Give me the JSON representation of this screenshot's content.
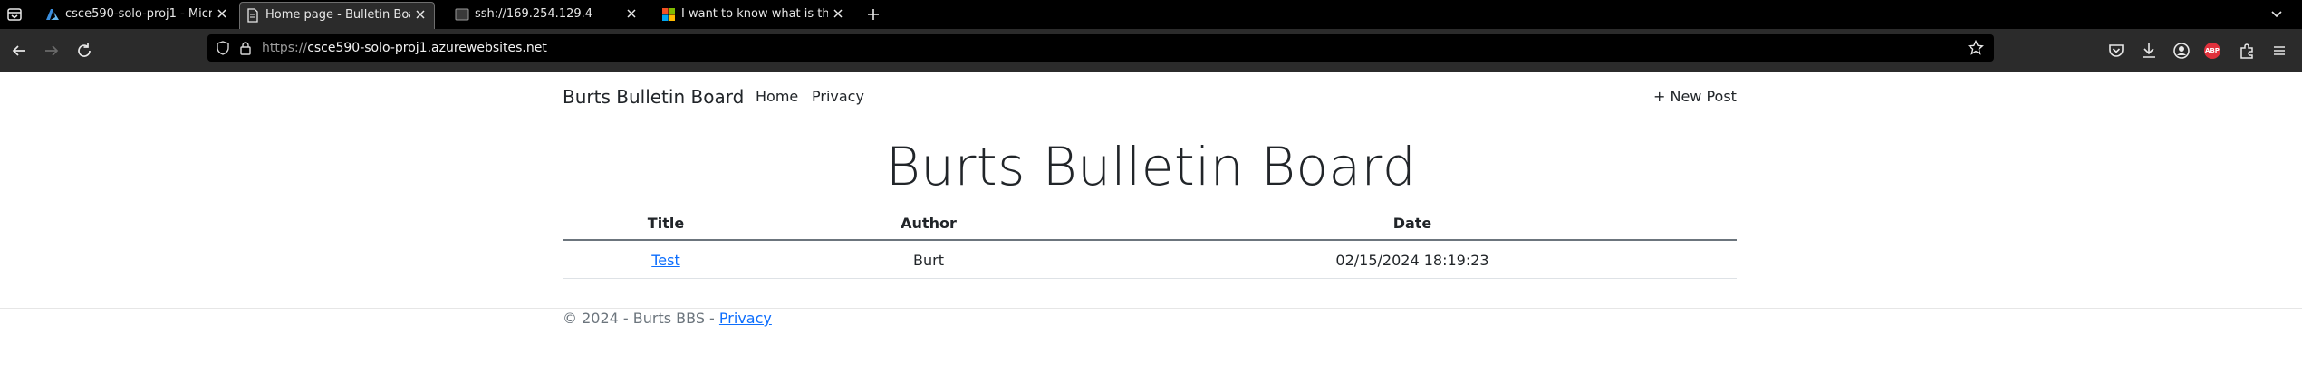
{
  "browser": {
    "tabs": [
      {
        "title": "csce590-solo-proj1 - Micro",
        "icon": "azure-icon",
        "active": false
      },
      {
        "title": "Home page - Bulletin Boar",
        "icon": "page-icon",
        "active": true
      },
      {
        "title": "ssh://169.254.129.4",
        "icon": "terminal-icon",
        "active": false
      },
      {
        "title": "I want to know what is the",
        "icon": "microsoft-icon",
        "active": false
      }
    ],
    "url_scheme": "https://",
    "url_host": "csce590-solo-proj1.azurewebsites.net",
    "abp_label": "ABP"
  },
  "site": {
    "brand": "Burts Bulletin Board",
    "nav": {
      "home": "Home",
      "privacy": "Privacy"
    },
    "new_post": "+ New Post",
    "heading": "Burts Bulletin Board",
    "table": {
      "headers": {
        "title": "Title",
        "author": "Author",
        "date": "Date"
      },
      "rows": [
        {
          "title": "Test",
          "author": "Burt",
          "date": "02/15/2024 18:19:23"
        }
      ]
    },
    "footer": {
      "text": "© 2024 - Burts BBS - ",
      "privacy_link": "Privacy"
    }
  },
  "colors": {
    "link": "#0d6efd",
    "text": "#212529",
    "muted": "#6c757d",
    "abp": "#e0303b"
  }
}
